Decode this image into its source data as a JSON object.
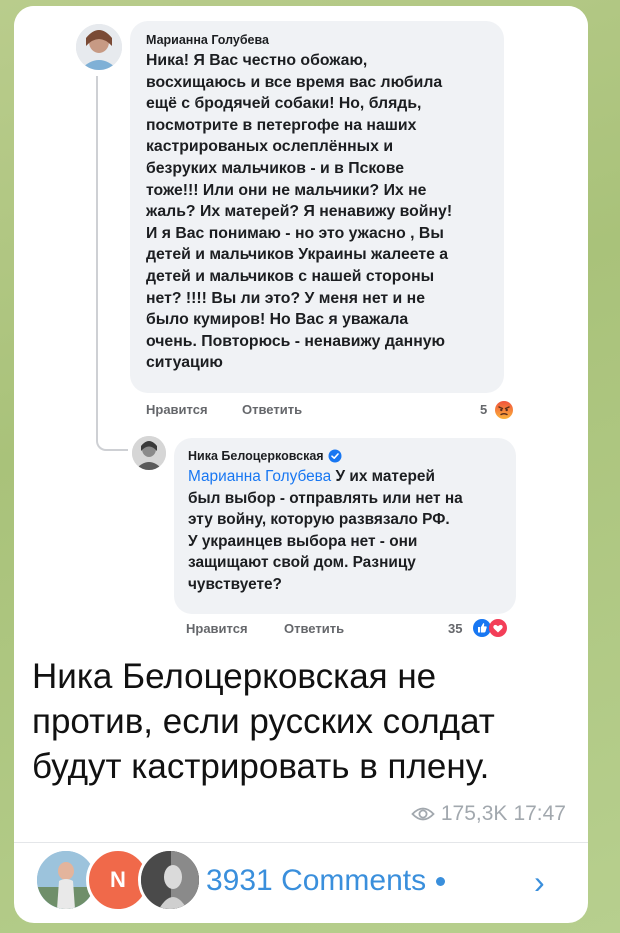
{
  "comment1": {
    "author": "Марианна Голубева",
    "lines": [
      "Ника! Я Вас честно обожаю,",
      "восхищаюсь и все время вас любила",
      "ещё с бродячей собаки! Но, блядь,",
      "посмотрите в петергофе на наших",
      "кастрированых ослеплённых и",
      "безруких мальчиков - и в Пскове",
      "тоже!!! Или они не мальчики? Их не",
      "жаль? Их матерей? Я ненавижу войну!",
      "И я Вас понимаю - но это ужасно , Вы",
      "детей и мальчиков Украины жалеете а",
      "детей и мальчиков с нашей стороны",
      "нет?  !!!! Вы ли это? У меня нет и не",
      "было кумиров! Но Вас я уважала",
      "очень.  Повторюсь - ненавижу данную",
      "ситуацию"
    ],
    "like_label": "Нравится",
    "reply_label": "Ответить",
    "reaction_count": "5"
  },
  "comment2": {
    "author": "Ника Белоцерковская",
    "mention": "Марианна Голубева",
    "first_line_rest": "  У их матерей",
    "lines": [
      "был выбор - отправлять или нет на",
      "эту войну, которую развязало РФ.",
      "У украинцев выбора нет - они",
      "защищают свой дом. Разницу",
      "чувствуете?"
    ],
    "like_label": "Нравится",
    "reply_label": "Ответить",
    "reaction_count": "35"
  },
  "post": {
    "caption_lines": [
      "Ника Белоцерковская не",
      "против, если русских солдат",
      "будут кастрировать в плену."
    ],
    "views": "175,3K",
    "time": "17:47"
  },
  "footer": {
    "comments_label": "3931 Comments"
  },
  "colors": {
    "background_green": "#b3c987",
    "link_blue": "#3a8fdc",
    "fb_blue": "#1877f2",
    "angry_orange": "#f5533d"
  }
}
